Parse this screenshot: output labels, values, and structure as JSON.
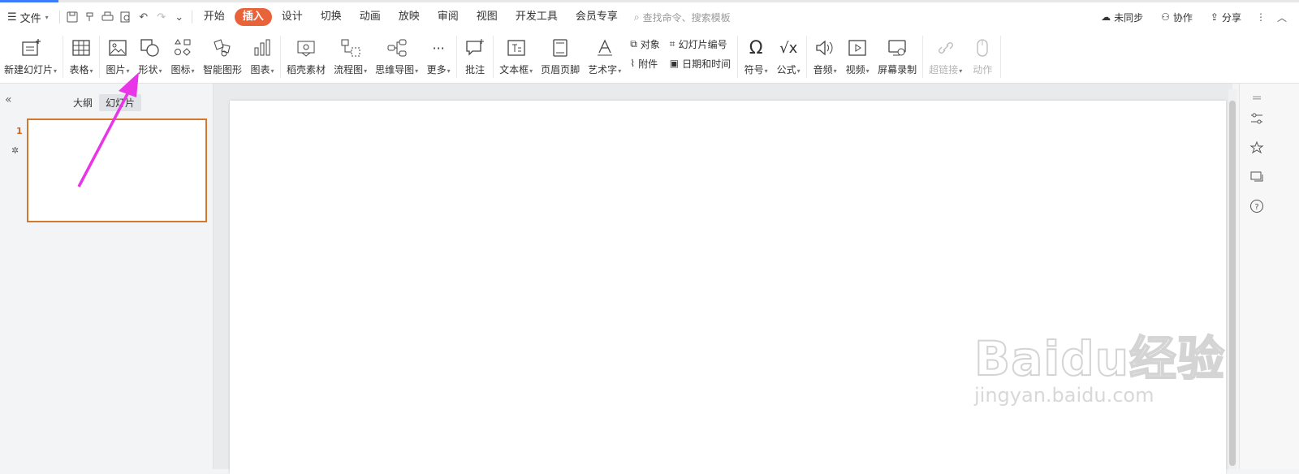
{
  "menu": {
    "file_label": "文件",
    "tabs": [
      "开始",
      "插入",
      "设计",
      "切换",
      "动画",
      "放映",
      "审阅",
      "视图",
      "开发工具",
      "会员专享"
    ],
    "active_tab": "插入",
    "search_placeholder": "查找命令、搜索模板",
    "right": {
      "sync": "未同步",
      "collab": "协作",
      "share": "分享"
    }
  },
  "ribbon": {
    "new_slide": "新建幻灯片",
    "table": "表格",
    "picture": "图片",
    "shape": "形状",
    "icon": "图标",
    "smartart": "智能图形",
    "chart": "图表",
    "docer": "稻壳素材",
    "flowchart": "流程图",
    "mindmap": "思维导图",
    "more": "更多",
    "comment": "批注",
    "textbox": "文本框",
    "header_footer": "页眉页脚",
    "wordart": "艺术字",
    "object": "对象",
    "attachment": "附件",
    "slide_number": "幻灯片编号",
    "datetime": "日期和时间",
    "symbol": "符号",
    "equation": "公式",
    "audio": "音频",
    "video": "视频",
    "screen_record": "屏幕录制",
    "hyperlink": "超链接",
    "action": "动作"
  },
  "left_panel": {
    "tab_outline": "大纲",
    "tab_slides": "幻灯片",
    "slide_number": "1"
  },
  "watermark": {
    "line1": "Baidu经验",
    "line2": "jingyan.baidu.com"
  },
  "colors": {
    "accent": "#e8623a",
    "thumb_border": "#d2782f",
    "arrow": "#e835e8"
  }
}
